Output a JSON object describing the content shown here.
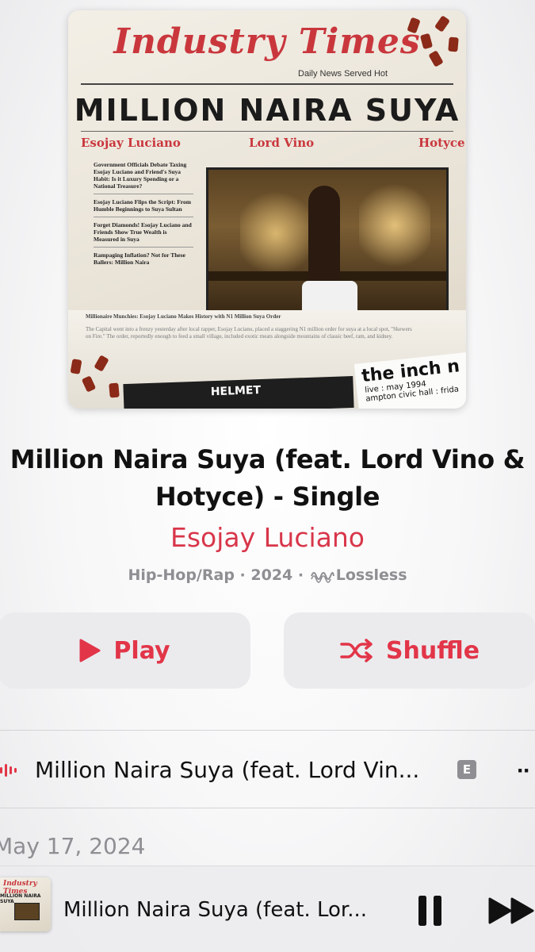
{
  "album_art": {
    "newspaper_name": "Industry Times",
    "tagline": "Daily News Served Hot",
    "headline": "MILLION NAIRA SUYA",
    "artists": [
      "Esojay Luciano",
      "Lord Vino",
      "Hotyce"
    ],
    "stories": [
      "Government Officials Debate Taxing Esojay Luciano and Friend's Suya Habit: Is it Luxury Spending or a National Treasure?",
      "Esojay Luciano Flips the Script: From Humble Beginnings to Suya Sultan",
      "Forget Diamonds! Esojay Luciano and Friends Show True Wealth is Measured in Suya",
      "Rampaging Inflation? Not for These Ballers: Million Naira"
    ],
    "article_headline": "Millionaire Munchies: Esojay Luciano Makes History with N1 Million Suya Order",
    "article_body": "The Capital went into a frenzy yesterday after local rapper, Esojay Luciano, placed a staggering N1 million order for suya at a local spot, \"Skewers on Fire.\" The order, reportedly enough to feed a small village, included exotic meats alongside mountains of classic beef, ram, and kidney.",
    "footer_left": "HELMET",
    "poster_big": "the inch n",
    "poster_small_1": "live : may 1994",
    "poster_small_2": "ampton civic hall : frida"
  },
  "album": {
    "title": "Million Naira Suya (feat. Lord Vino & Hotyce) - Single",
    "artist": "Esojay Luciano",
    "genre": "Hip-Hop/Rap",
    "year": "2024",
    "quality": "Lossless",
    "separator": " · "
  },
  "buttons": {
    "play": "Play",
    "shuffle": "Shuffle"
  },
  "tracks": [
    {
      "title": "Million Naira Suya (feat. Lord Vin...",
      "explicit_badge": "E",
      "more": "··"
    }
  ],
  "release_date": "May 17, 2024",
  "mini_player": {
    "title": "Million Naira Suya (feat. Lor...",
    "art_title": "Industry Times",
    "art_headline": "MILLION NAIRA SUYA"
  },
  "colors": {
    "accent": "#e23548",
    "artist": "#d8364a",
    "secondary_text": "#8e8e93",
    "button_bg": "#ebebee"
  },
  "icons": [
    "play-icon",
    "shuffle-icon",
    "lossless-icon",
    "now-playing-bars-icon",
    "explicit-icon",
    "more-icon",
    "pause-icon",
    "fast-forward-icon"
  ]
}
